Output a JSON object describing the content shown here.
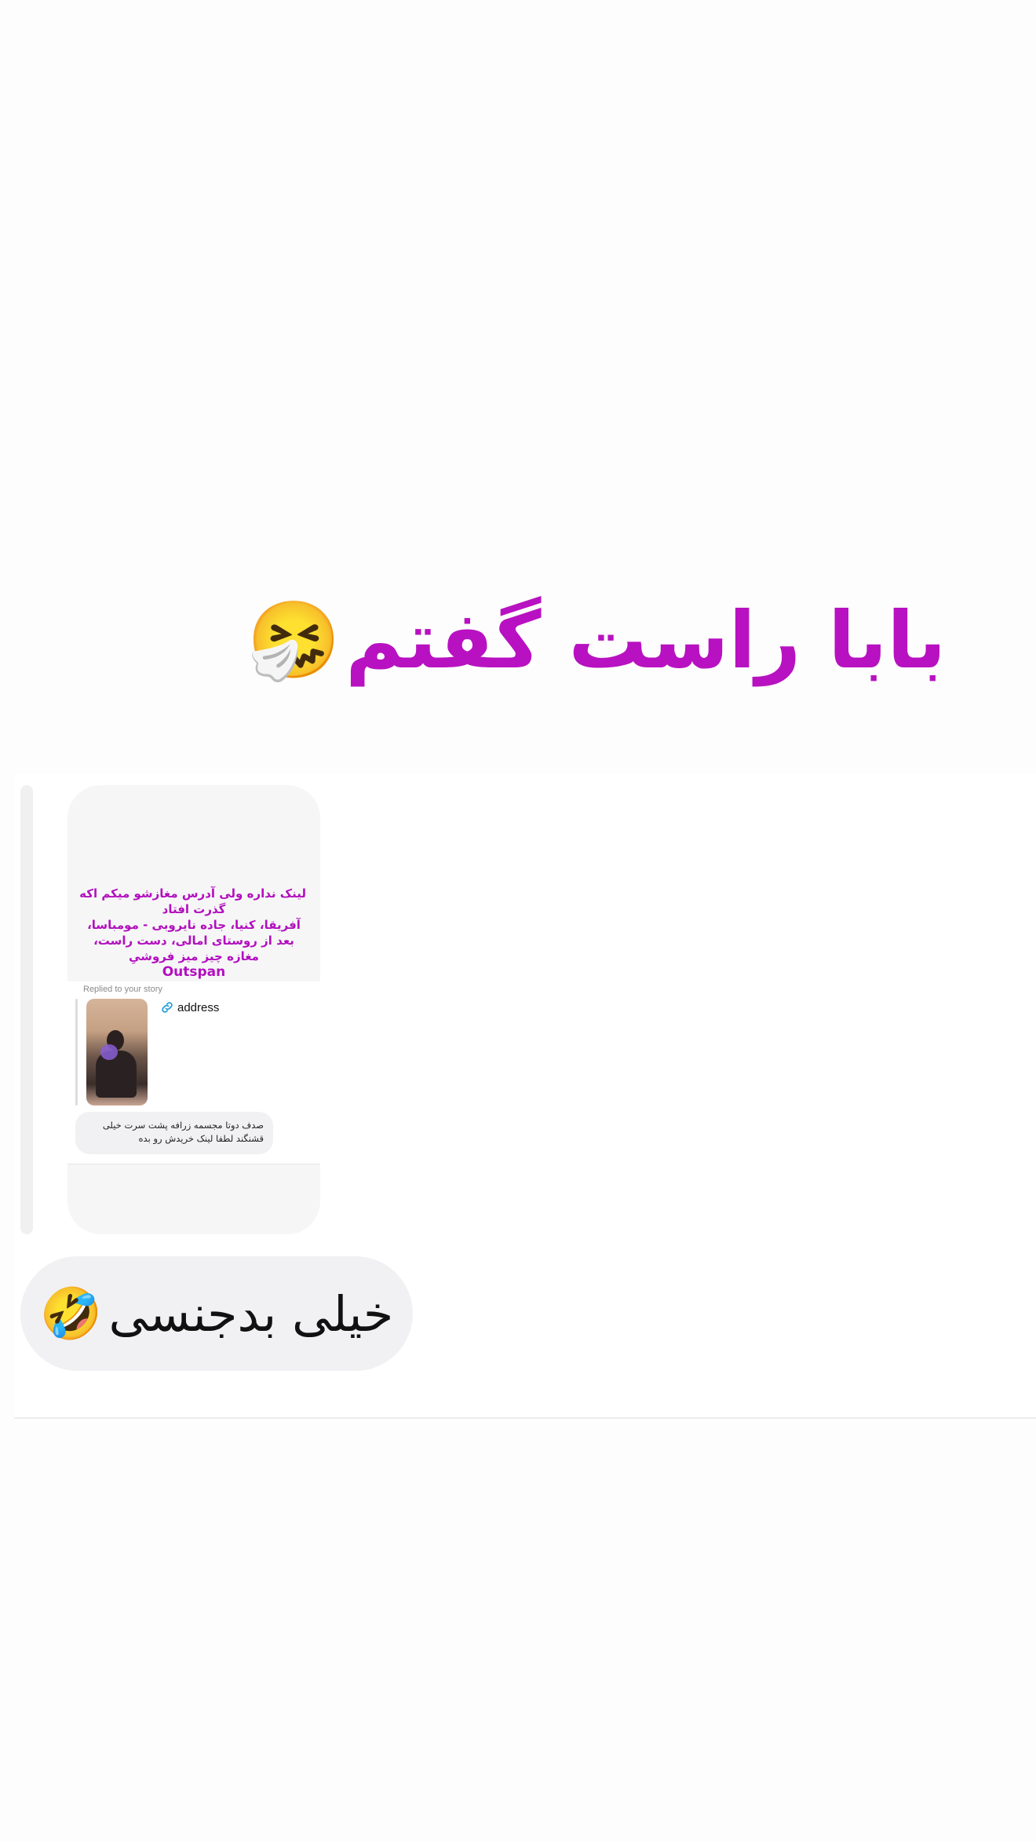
{
  "headline": {
    "text": "بابا راست گفتم",
    "emoji": "🤧",
    "color": "#b811c1"
  },
  "story_card": {
    "caption_lines": [
      "لینک نداره ولی آدرس مغازشو میکم اکه",
      "گذرت افتاد",
      "آفریقا، کنیا، جاده نایروبی - مومباسا،",
      "بعد از روستای امالی، دست راست،",
      "مغازه چیز میز فروشیِ"
    ],
    "brand": "Outspan",
    "replied_label": "Replied to your story",
    "link_label": "address",
    "message": "صدف دوتا مجسمه زرافه پشت سرت خیلی قشنگند لطفا لینک خریدش رو بده",
    "accent_color": "#b20fbe"
  },
  "reply": {
    "text": "خیلی بدجنسی",
    "emoji": "🤣"
  }
}
